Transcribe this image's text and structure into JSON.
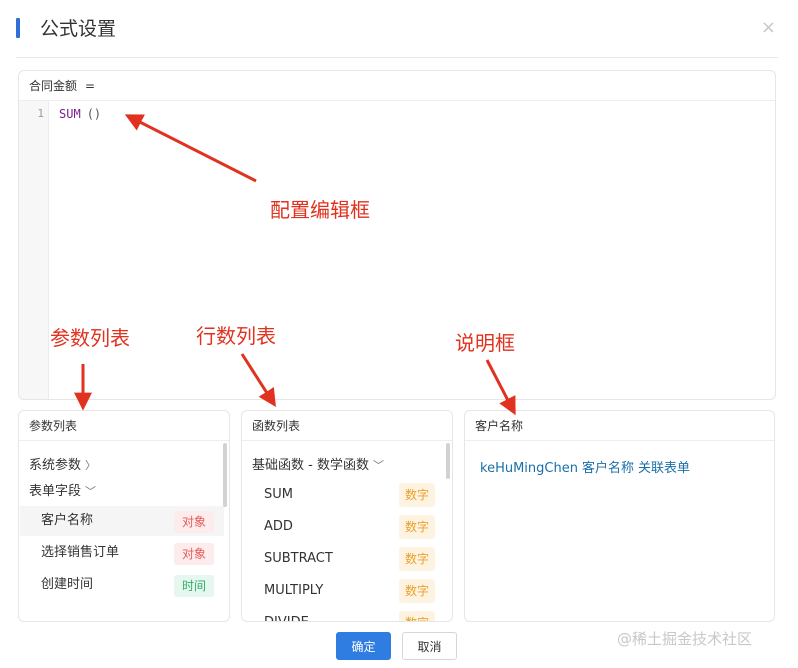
{
  "dialog": {
    "title": "公式设置",
    "close_glyph": "×"
  },
  "editor": {
    "field_name": "合同金额",
    "equals": "=",
    "line_number": "1",
    "code_fn": "SUM",
    "code_paren": "()"
  },
  "params_panel": {
    "title": "参数列表",
    "groups": [
      {
        "label": "系统参数",
        "chevron": "〉"
      },
      {
        "label": "表单字段",
        "chevron": "﹀"
      }
    ],
    "items": [
      {
        "label": "客户名称",
        "tag": "对象"
      },
      {
        "label": "选择销售订单",
        "tag": "对象"
      },
      {
        "label": "创建时间",
        "tag": "时间"
      }
    ]
  },
  "functions_panel": {
    "title": "函数列表",
    "group": {
      "label": "基础函数 - 数学函数",
      "chevron": "﹀"
    },
    "items": [
      {
        "label": "SUM",
        "tag": "数字"
      },
      {
        "label": "ADD",
        "tag": "数字"
      },
      {
        "label": "SUBTRACT",
        "tag": "数字"
      },
      {
        "label": "MULTIPLY",
        "tag": "数字"
      },
      {
        "label": "DIVIDE",
        "tag": "数字"
      }
    ]
  },
  "desc_panel": {
    "title": "客户名称",
    "text": [
      "keHuMingChen",
      "客户名称",
      "关联表单"
    ]
  },
  "buttons": {
    "ok": "确定",
    "cancel": "取消"
  },
  "annotations": {
    "editor": "配置编辑框",
    "params": "参数列表",
    "functions": "行数列表",
    "desc": "说明框"
  },
  "watermark": "@稀土掘金技术社区",
  "colors": {
    "accent": "#2f6fd6",
    "primary_button": "#2f7de1",
    "annotation_red": "#e0321f",
    "tag_object": "#e85a5a",
    "tag_time": "#2fae6a",
    "tag_number": "#e9a02b",
    "code_fn": "#7a1f8f",
    "desc_text": "#1a6fa8"
  }
}
